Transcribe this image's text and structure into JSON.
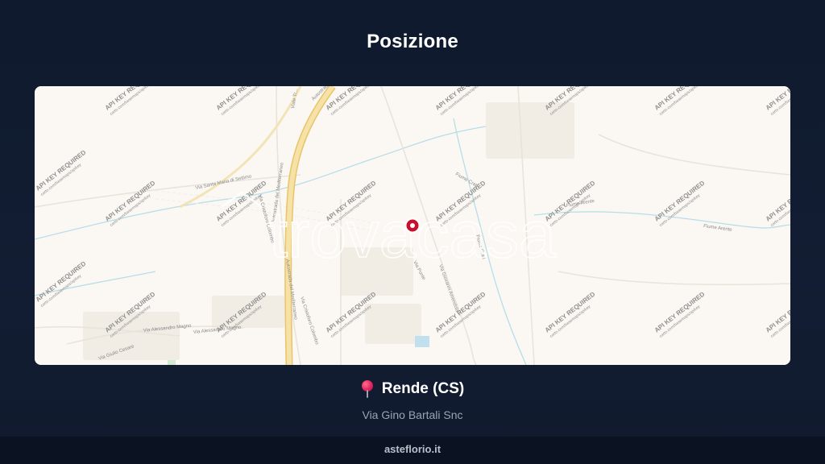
{
  "header": {
    "title": "Posizione"
  },
  "map": {
    "watermark_brand": "trovacasa",
    "tile_watermark": "API KEY REQUIRED",
    "tile_watermark_sub": "carto.com/basemaps/apikey",
    "road_labels": [
      "Viale Tr...",
      "Autostrada",
      "Autostrada del Mediterraneo",
      "Via Santa Maria di Settimo",
      "Via Cristoforo Colombo",
      "Autostrada del Mediterraneo",
      "Via Alessandro Magno",
      "Via Alessandro Magno",
      "Via Giulio Cesare",
      "Via Cristoforo Colombo",
      "Fiume Crati",
      "Fiume Arente",
      "Fiume Arente",
      "Via Ponte",
      "Via Giovanni Amendola",
      "Fiume Crati"
    ],
    "marker_color": "#c8102e"
  },
  "location": {
    "pin_icon": "round-pushpin-icon",
    "city": "Rende (CS)",
    "address": "Via Gino Bartali Snc"
  },
  "footer": {
    "site": "asteflorio.it"
  },
  "colors": {
    "background": "#0f1a2e",
    "map_land": "#fbf8f3",
    "motorway": "#f2d27a",
    "river": "#a9d8e6",
    "address_text": "#9aa4b5"
  }
}
